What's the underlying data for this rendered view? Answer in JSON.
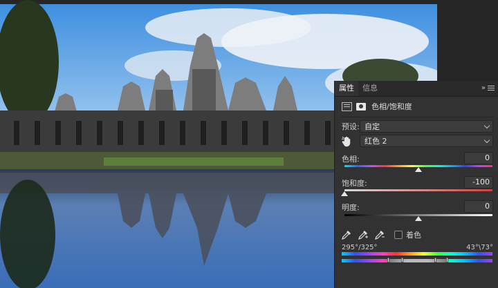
{
  "panel": {
    "tabs": [
      "属性",
      "信息"
    ],
    "active_tab": 0,
    "collapse_glyph": "»",
    "adjustment_name": "色相/饱和度",
    "preset": {
      "label": "预设:",
      "value": "自定"
    },
    "channel": {
      "value": "红色 2"
    },
    "hue": {
      "label": "色相:",
      "value": "0",
      "level": 0.5
    },
    "saturation": {
      "label": "饱和度:",
      "value": "-100",
      "level": 0.0
    },
    "lightness": {
      "label": "明度:",
      "value": "0",
      "level": 0.5
    },
    "colorize": {
      "label": "着色",
      "checked": false
    },
    "range_left": "295°/325°",
    "range_right": "43°\\73°",
    "icons": [
      "adjustment-layer-icon",
      "mask-icon",
      "hand-target-icon",
      "eyedropper-icon",
      "eyedropper-plus-icon",
      "eyedropper-minus-icon"
    ]
  }
}
